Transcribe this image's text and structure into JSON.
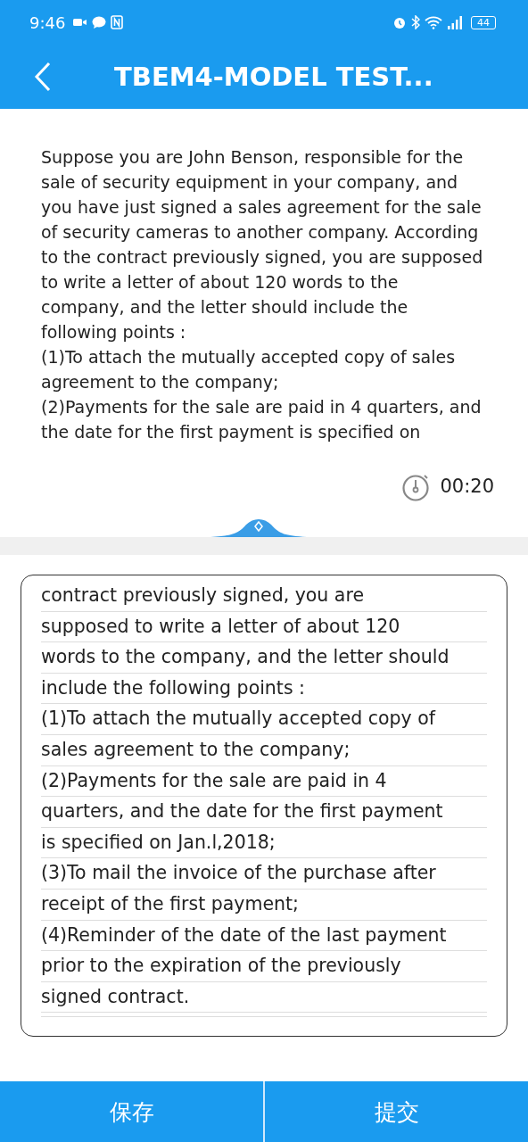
{
  "status_bar": {
    "time": "9:46",
    "battery": "44"
  },
  "header": {
    "title": "TBEM4-MODEL TEST..."
  },
  "prompt": {
    "paragraphs": [
      "Suppose you are John Benson, responsible for the sale of security equipment in your company, and you have just signed a sales agreement for the sale of security cameras to another company. According to the contract previously signed, you are supposed to write a letter of about 120 words to the company, and the letter should include the following points :",
      "(1)To attach the mutually accepted copy of sales agreement to the company;",
      "(2)Payments for the sale are paid in 4 quarters, and the date for the first payment is specified on"
    ]
  },
  "timer": "00:20",
  "answer": {
    "lines": [
      "contract previously signed, you are",
      "supposed to write a letter of about 120",
      "words to the company, and the letter should",
      "include the following points :",
      "(1)To attach the mutually accepted copy of",
      "sales agreement to the company;",
      "(2)Payments for the sale are paid in 4",
      "quarters, and the date for the first payment",
      "is specified on Jan.l,2018;",
      "(3)To mail the invoice of the purchase after",
      "receipt of the first payment;",
      "(4)Reminder of the date of the last payment",
      "prior to the expiration of the previously",
      "signed contract."
    ]
  },
  "buttons": [
    "保存",
    "提交"
  ]
}
